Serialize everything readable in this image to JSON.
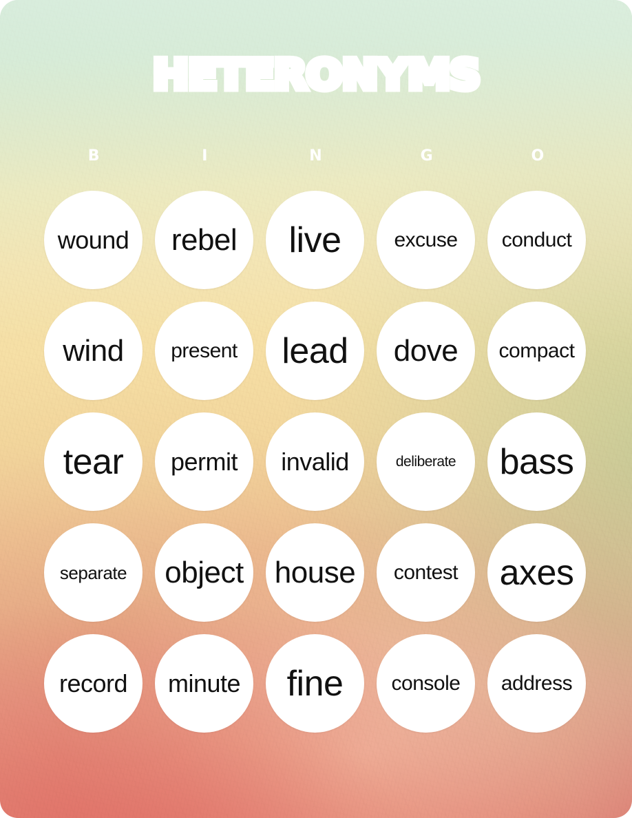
{
  "card": {
    "title": "Heteronyms",
    "theme": {
      "top_color": "#a9d7b3",
      "mid_color": "#f4e1a6",
      "bottom_color": "#dd7470",
      "cell_color": "#ffffff",
      "word_color": "#111111",
      "title_color": "#ffffff"
    }
  },
  "bingo_header": {
    "letters": [
      "B",
      "I",
      "N",
      "G",
      "O"
    ]
  },
  "grid": {
    "columns": 5,
    "rows": 5,
    "cells": [
      {
        "word": "wound",
        "size": "s-lg",
        "column": "B",
        "row": 1
      },
      {
        "word": "rebel",
        "size": "s-xl",
        "column": "I",
        "row": 1
      },
      {
        "word": "live",
        "size": "s-xxl",
        "column": "N",
        "row": 1
      },
      {
        "word": "excuse",
        "size": "s-md",
        "column": "G",
        "row": 1
      },
      {
        "word": "conduct",
        "size": "s-md",
        "column": "O",
        "row": 1
      },
      {
        "word": "wind",
        "size": "s-xl",
        "column": "B",
        "row": 2
      },
      {
        "word": "present",
        "size": "s-md",
        "column": "I",
        "row": 2
      },
      {
        "word": "lead",
        "size": "s-xxl",
        "column": "N",
        "row": 2
      },
      {
        "word": "dove",
        "size": "s-xl",
        "column": "G",
        "row": 2
      },
      {
        "word": "compact",
        "size": "s-md",
        "column": "O",
        "row": 2
      },
      {
        "word": "tear",
        "size": "s-xxl",
        "column": "B",
        "row": 3
      },
      {
        "word": "permit",
        "size": "s-lg",
        "column": "I",
        "row": 3
      },
      {
        "word": "invalid",
        "size": "s-lg",
        "column": "N",
        "row": 3
      },
      {
        "word": "deliberate",
        "size": "s-xs",
        "column": "G",
        "row": 3
      },
      {
        "word": "bass",
        "size": "s-xxl",
        "column": "O",
        "row": 3
      },
      {
        "word": "separate",
        "size": "s-sm",
        "column": "B",
        "row": 4
      },
      {
        "word": "object",
        "size": "s-xl",
        "column": "I",
        "row": 4
      },
      {
        "word": "house",
        "size": "s-xl",
        "column": "N",
        "row": 4
      },
      {
        "word": "contest",
        "size": "s-md",
        "column": "G",
        "row": 4
      },
      {
        "word": "axes",
        "size": "s-xxl",
        "column": "O",
        "row": 4
      },
      {
        "word": "record",
        "size": "s-lg",
        "column": "B",
        "row": 5
      },
      {
        "word": "minute",
        "size": "s-lg",
        "column": "I",
        "row": 5
      },
      {
        "word": "fine",
        "size": "s-xxl",
        "column": "N",
        "row": 5
      },
      {
        "word": "console",
        "size": "s-md",
        "column": "G",
        "row": 5
      },
      {
        "word": "address",
        "size": "s-md",
        "column": "O",
        "row": 5
      }
    ]
  }
}
